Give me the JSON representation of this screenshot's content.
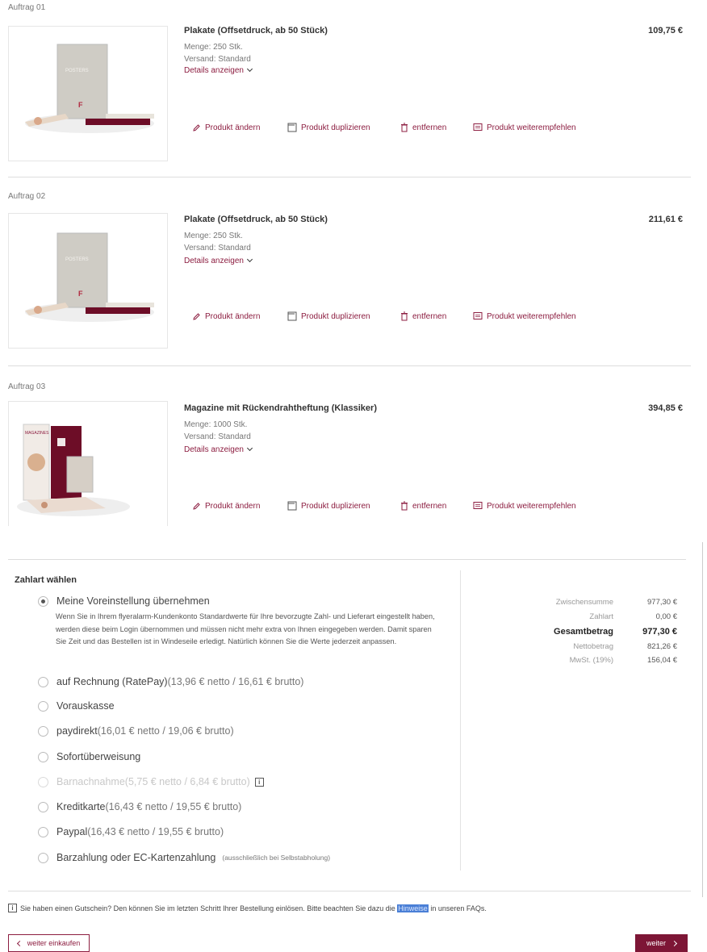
{
  "orders": [
    {
      "label": "Auftrag 01",
      "title": "Plakate (Offsetdruck, ab 50 Stück)",
      "quantity": "Menge: 250 Stk.",
      "shipping": "Versand: Standard",
      "details": "Details anzeigen",
      "price": "109,75 €",
      "image_text": "POSTERS"
    },
    {
      "label": "Auftrag 02",
      "title": "Plakate (Offsetdruck, ab 50 Stück)",
      "quantity": "Menge: 250 Stk.",
      "shipping": "Versand: Standard",
      "details": "Details anzeigen",
      "price": "211,61 €",
      "image_text": "POSTERS"
    },
    {
      "label": "Auftrag 03",
      "title": "Magazine mit Rückendrahtheftung (Klassiker)",
      "quantity": "Menge: 1000 Stk.",
      "shipping": "Versand: Standard",
      "details": "Details anzeigen",
      "price": "394,85 €",
      "image_text": "MAGAZINES"
    }
  ],
  "actions": {
    "edit": "Produkt ändern",
    "duplicate": "Produkt duplizieren",
    "remove": "entfernen",
    "recommend": "Produkt weiterempfehlen"
  },
  "payment": {
    "title": "Zahlart wählen",
    "default_option": "Meine Voreinstellung übernehmen",
    "default_desc": "Wenn Sie in Ihrem flyeralarm-Kundenkonto Standardwerte für Ihre bevorzugte Zahl- und Lieferart eingestellt haben, werden diese beim Login übernommen und müssen nicht mehr extra von Ihnen eingegeben werden. Damit sparen Sie Zeit und das Bestellen ist in Windeseile erledigt. Natürlich können Sie die Werte jederzeit anpassen.",
    "options": [
      {
        "label": "auf Rechnung (RatePay)",
        "sub": " (13,96 € netto / 16,61 € brutto)"
      },
      {
        "label": "Vorauskasse",
        "sub": ""
      },
      {
        "label": "paydirekt",
        "sub": " (16,01 € netto / 19,06 € brutto)"
      },
      {
        "label": "Sofortüberweisung",
        "sub": ""
      },
      {
        "label": "Barnachnahme",
        "sub": " (5,75 € netto / 6,84 € brutto)"
      },
      {
        "label": "Kreditkarte",
        "sub": " (16,43 € netto / 19,55 € brutto)"
      },
      {
        "label": "Paypal",
        "sub": " (16,43 € netto / 19,55 € brutto)"
      },
      {
        "label": "Barzahlung oder EC-Kartenzahlung",
        "sub": "(ausschließlich bei Selbstabholung)"
      }
    ],
    "info_glyph": "i"
  },
  "summary": {
    "subtotal_label": "Zwischensumme",
    "subtotal_value": "977,30 €",
    "payment_label": "Zahlart",
    "payment_value": "0,00 €",
    "total_label": "Gesamtbetrag",
    "total_value": "977,30 €",
    "net_label": "Nettobetrag",
    "net_value": "821,26 €",
    "vat_label": "MwSt. (19%)",
    "vat_value": "156,04 €"
  },
  "voucher": {
    "before": "Sie haben einen Gutschein? Den können Sie im letzten Schritt Ihrer Bestellung einlösen. Bitte beachten Sie dazu die ",
    "link": "Hinweise",
    "after": " in unseren FAQs."
  },
  "nav": {
    "back": "weiter einkaufen",
    "next": "weiter"
  },
  "colors": {
    "accent": "#8c1d40",
    "button": "#7d1636"
  }
}
